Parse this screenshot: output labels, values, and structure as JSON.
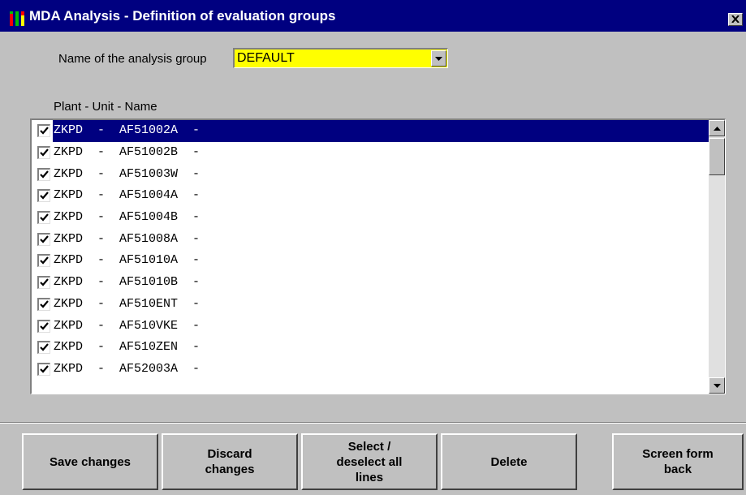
{
  "window": {
    "title": "MDA Analysis - Definition of evaluation groups",
    "titlebar_color": "#000080",
    "icons": {
      "app": "bar-chart-app-icon",
      "close": "close-icon"
    }
  },
  "group": {
    "label": "Name of the analysis group",
    "selected": "DEFAULT",
    "highlight_color": "#ffff00"
  },
  "list": {
    "header": "Plant - Unit - Name",
    "selected_index": 0,
    "rows": [
      {
        "text": "ZKPD  -  AF51002A  -",
        "checked": true
      },
      {
        "text": "ZKPD  -  AF51002B  -",
        "checked": true
      },
      {
        "text": "ZKPD  -  AF51003W  -",
        "checked": true
      },
      {
        "text": "ZKPD  -  AF51004A  -",
        "checked": true
      },
      {
        "text": "ZKPD  -  AF51004B  -",
        "checked": true
      },
      {
        "text": "ZKPD  -  AF51008A  -",
        "checked": true
      },
      {
        "text": "ZKPD  -  AF51010A  -",
        "checked": true
      },
      {
        "text": "ZKPD  -  AF51010B  -",
        "checked": true
      },
      {
        "text": "ZKPD  -  AF510ENT  -",
        "checked": true
      },
      {
        "text": "ZKPD  -  AF510VKE  -",
        "checked": true
      },
      {
        "text": "ZKPD  -  AF510ZEN  -",
        "checked": true
      },
      {
        "text": "ZKPD  -  AF52003A  -",
        "checked": true
      }
    ]
  },
  "buttons": {
    "save": "Save changes",
    "discard": "Discard\nchanges",
    "select_all": "Select /\ndeselect all\nlines",
    "delete": "Delete",
    "back": "Screen form\nback"
  }
}
